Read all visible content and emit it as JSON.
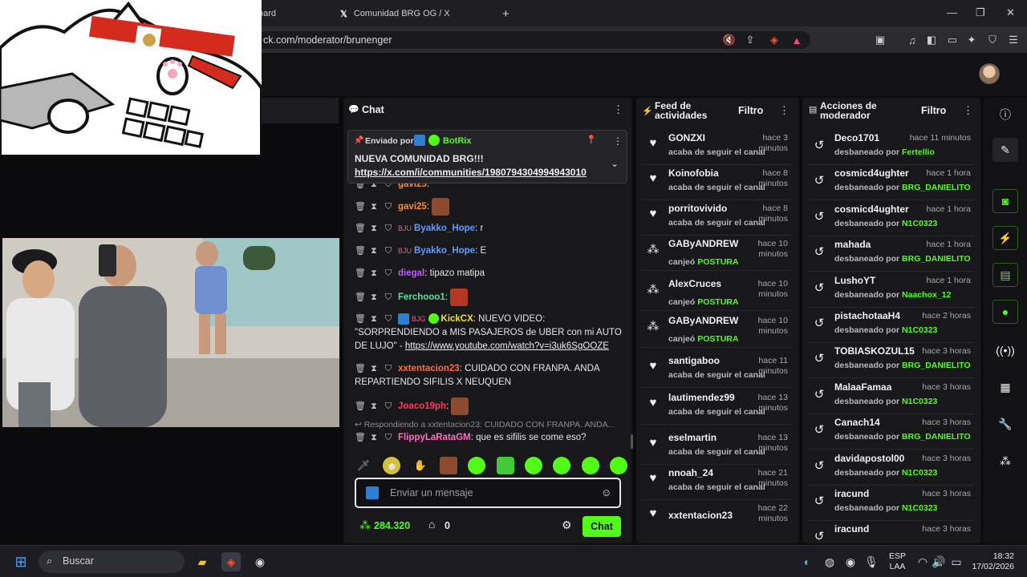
{
  "browser": {
    "tabs": [
      {
        "label": "oard"
      },
      {
        "label": "Comunidad BRG OG / X"
      }
    ],
    "url": "ck.com/moderator/brunenger"
  },
  "chat": {
    "title": "Chat",
    "pinned": {
      "sent_by": "Enviado por",
      "author": "BotRix",
      "text": "NUEVA COMUNIDAD BRG!!!",
      "link": "https://x.com/i/communities/1980794304994943010"
    },
    "messages": [
      {
        "user": "gavi25",
        "text": "",
        "emote": true,
        "color": "#ff8a2b"
      },
      {
        "user": "gavi25",
        "text": "",
        "emote": true,
        "color": "#ff8a2b"
      },
      {
        "user": "Byakko_Hope",
        "text": ": r",
        "color": "#5f9cff"
      },
      {
        "user": "Byakko_Hope",
        "text": ": E",
        "color": "#5f9cff"
      },
      {
        "user": "diegal",
        "text": ": tipazo matipa",
        "color": "#c25bff"
      },
      {
        "user": "Ferchooo1",
        "text": ":",
        "emote": true,
        "color": "#53e0a0"
      },
      {
        "user": "KickCX",
        "text": ": NUEVO VIDEO:",
        "line2": "\"SORPRENDIENDO a MIS PASAJEROS de UBER con mi AUTO",
        "line3a": "DE LUJO\" - ",
        "link": "https://www.youtube.com/watch?v=i3uk6SgOOZE",
        "color": "#f2e233"
      },
      {
        "user": "xxtentacion23",
        "text": ": CUIDADO CON FRANPA. ANDA",
        "line2": "REPARTIENDO SIFILIS X NEUQUEN",
        "color": "#ff6b3d"
      },
      {
        "user": "Joaco19ph",
        "text": ":",
        "emote": true,
        "color": "#ff3d5a"
      },
      {
        "user": "FlippyLaRataGM",
        "text": ": que es sifilis se come eso?",
        "reply": "Respondiendo a xxtentacion23: CUIDADO CON FRANPA. ANDA...",
        "color": "#ff6bc8"
      }
    ],
    "input_placeholder": "Enviar un mensaje",
    "points": "284.320",
    "store_count": "0",
    "send_label": "Chat"
  },
  "feed": {
    "title_line1": "Feed de",
    "title_line2": "actividades",
    "filter": "Filtro",
    "items": [
      {
        "icon": "heart-icon",
        "name": "GONZXI",
        "time": "hace 3 minutos",
        "action": "acaba de seguir el canal"
      },
      {
        "icon": "heart-icon",
        "name": "Koinofobia",
        "time": "hace 8 minutos",
        "action": "acaba de seguir el canal"
      },
      {
        "icon": "heart-icon",
        "name": "porritovivido",
        "time": "hace 8 minutos",
        "action": "acaba de seguir el canal"
      },
      {
        "icon": "points-icon",
        "name": "GAByANDREW",
        "time": "hace 10 minutos",
        "action": "canjeó",
        "reward": "POSTURA"
      },
      {
        "icon": "points-icon",
        "name": "AlexCruces",
        "time": "hace 10 minutos",
        "action": "canjeó",
        "reward": "POSTURA"
      },
      {
        "icon": "points-icon",
        "name": "GAByANDREW",
        "time": "hace 10 minutos",
        "action": "canjeó",
        "reward": "POSTURA"
      },
      {
        "icon": "heart-icon",
        "name": "santigaboo",
        "time": "hace 11 minutos",
        "action": "acaba de seguir el canal"
      },
      {
        "icon": "heart-icon",
        "name": "lautimendez99",
        "time": "hace 13 minutos",
        "action": "acaba de seguir el canal"
      },
      {
        "icon": "heart-icon",
        "name": "eselmartin",
        "time": "hace 13 minutos",
        "action": "acaba de seguir el canal"
      },
      {
        "icon": "heart-icon",
        "name": "nnoah_24",
        "time": "hace 21 minutos",
        "action": "acaba de seguir el canal"
      },
      {
        "icon": "heart-icon",
        "name": "xxtentacion23",
        "time": "hace 22 minutos",
        "action": ""
      }
    ]
  },
  "mod": {
    "title_line1": "Acciones de",
    "title_line2": "moderador",
    "filter": "Filtro",
    "items": [
      {
        "name": "Deco1701",
        "time": "hace 11 minutos",
        "action": "desbaneado por",
        "by": "Fertellio"
      },
      {
        "name": "cosmicd4ughter",
        "time": "hace 1 hora",
        "action": "desbaneado por",
        "by": "BRG_DANIELITO"
      },
      {
        "name": "cosmicd4ughter",
        "time": "hace 1 hora",
        "action": "desbaneado por",
        "by": "N1C0323"
      },
      {
        "name": "mahada",
        "time": "hace 1 hora",
        "action": "desbaneado por",
        "by": "BRG_DANIELITO"
      },
      {
        "name": "LushoYT",
        "time": "hace 1 hora",
        "action": "desbaneado por",
        "by": "Naachox_12"
      },
      {
        "name": "pistachotaaH4",
        "time": "hace 2 horas",
        "action": "desbaneado por",
        "by": "N1C0323"
      },
      {
        "name": "TOBIASKOZUL15",
        "time": "hace 3 horas",
        "action": "desbaneado por",
        "by": "BRG_DANIELITO"
      },
      {
        "name": "MalaaFamaa",
        "time": "hace 3 horas",
        "action": "desbaneado por",
        "by": "N1C0323"
      },
      {
        "name": "Canach14",
        "time": "hace 3 horas",
        "action": "desbaneado por",
        "by": "BRG_DANIELITO"
      },
      {
        "name": "davidapostol00",
        "time": "hace 3 horas",
        "action": "desbaneado por",
        "by": "N1C0323"
      },
      {
        "name": "iracund",
        "time": "hace 3 horas",
        "action": "desbaneado por",
        "by": "N1C0323"
      },
      {
        "name": "iracund",
        "time": "hace 3 horas",
        "action": "",
        "by": ""
      }
    ]
  },
  "taskbar": {
    "search_placeholder": "Buscar",
    "lang1": "ESP",
    "lang2": "LAA",
    "time": "18:32",
    "date": "17/02/2026"
  }
}
